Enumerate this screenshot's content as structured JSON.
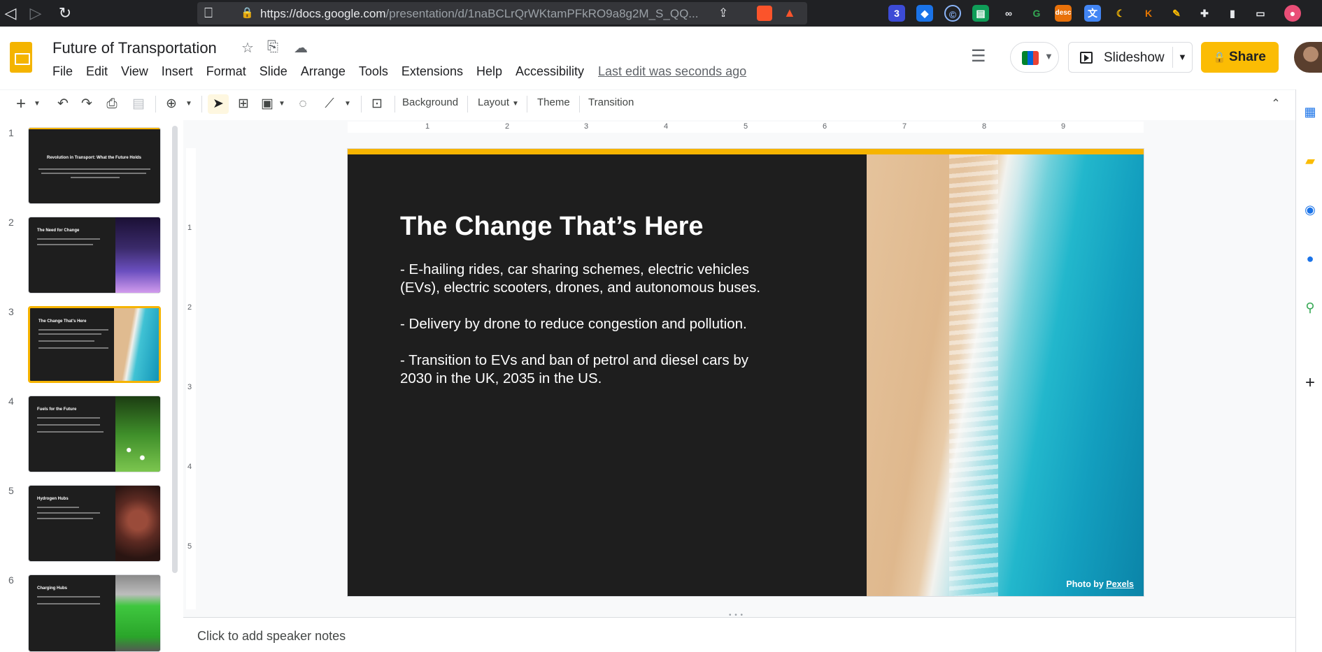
{
  "browser": {
    "url_host": "https://docs.google.com",
    "url_path": "/presentation/d/1naBCLrQrWKtamPFkRO9a8g2M_S_QQ...",
    "extension_badge_1": "3",
    "extension_badge_2": "desc"
  },
  "header": {
    "doc_title": "Future of Transportation",
    "last_edit": "Last edit was seconds ago",
    "slideshow_label": "Slideshow",
    "share_label": "Share"
  },
  "menu": {
    "items": [
      "File",
      "Edit",
      "View",
      "Insert",
      "Format",
      "Slide",
      "Arrange",
      "Tools",
      "Extensions",
      "Help",
      "Accessibility"
    ]
  },
  "toolbar": {
    "background": "Background",
    "layout": "Layout",
    "theme": "Theme",
    "transition": "Transition"
  },
  "filmstrip": {
    "selected_index": 3,
    "slides": [
      {
        "num": "1",
        "title": "Revolution in Transport: What the Future Holds"
      },
      {
        "num": "2",
        "title": "The Need for Change"
      },
      {
        "num": "3",
        "title": "The Change That's Here"
      },
      {
        "num": "4",
        "title": "Fuels for the Future"
      },
      {
        "num": "5",
        "title": "Hydrogen Hubs"
      },
      {
        "num": "6",
        "title": "Charging Hubs"
      }
    ]
  },
  "ruler": {
    "h": [
      "1",
      "2",
      "3",
      "4",
      "5",
      "6",
      "7",
      "8",
      "9"
    ],
    "v": [
      "1",
      "2",
      "3",
      "4",
      "5"
    ]
  },
  "slide": {
    "title": "The Change That’s Here",
    "bullets": [
      "-  E-hailing rides, car sharing schemes, electric vehicles (EVs), electric scooters, drones, and autonomous buses.",
      "-  Delivery by drone to reduce congestion and pollution.",
      "-  Transition to EVs and ban of petrol and diesel cars by 2030 in the UK, 2035 in the US."
    ],
    "photo_credit_prefix": "Photo by ",
    "photo_credit_link": "Pexels"
  },
  "notes": {
    "placeholder": "Click to add speaker notes"
  },
  "colors": {
    "accent": "#fbbc04",
    "slide_bg": "#1e1e1e",
    "slide_bar": "#f6b400"
  }
}
